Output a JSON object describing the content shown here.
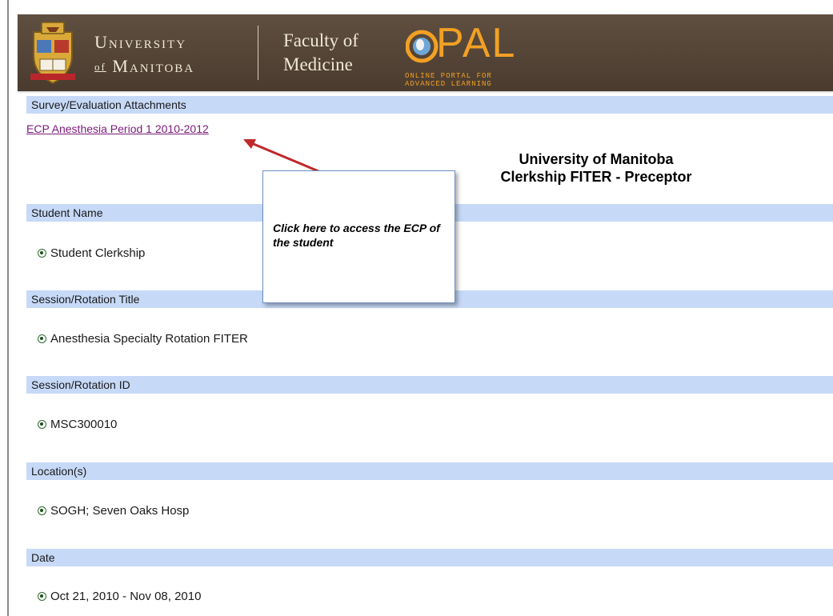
{
  "header": {
    "university_line1": "University",
    "university_line2_prefix": "of",
    "university_line2": "Manitoba",
    "faculty_line1": "Faculty of",
    "faculty_line2": "Medicine",
    "opal_word": "PAL",
    "opal_sub_line1": "ONLINE PORTAL FOR",
    "opal_sub_line2": "ADVANCED LEARNING"
  },
  "attachments": {
    "section_label": "Survey/Evaluation Attachments",
    "link_text": "ECP Anesthesia Period 1 2010-2012"
  },
  "form_title": {
    "line1": "University of Manitoba",
    "line2": "Clerkship FITER - Preceptor"
  },
  "callout": {
    "text": "Click here to access the ECP of the student"
  },
  "fields": [
    {
      "label": "Student Name",
      "value": "Student Clerkship"
    },
    {
      "label": "Session/Rotation Title",
      "value": "Anesthesia Specialty Rotation FITER"
    },
    {
      "label": "Session/Rotation ID",
      "value": "MSC300010"
    },
    {
      "label": "Location(s)",
      "value": "SOGH; Seven Oaks Hosp"
    },
    {
      "label": "Date",
      "value": "Oct 21, 2010 - Nov 08, 2010"
    }
  ],
  "colors": {
    "header_bg": "#4a3b2f",
    "section_bar": "#c6d9f7",
    "link": "#7a1a7a",
    "opal_orange": "#f2a024",
    "arrow": "#c0282a"
  }
}
